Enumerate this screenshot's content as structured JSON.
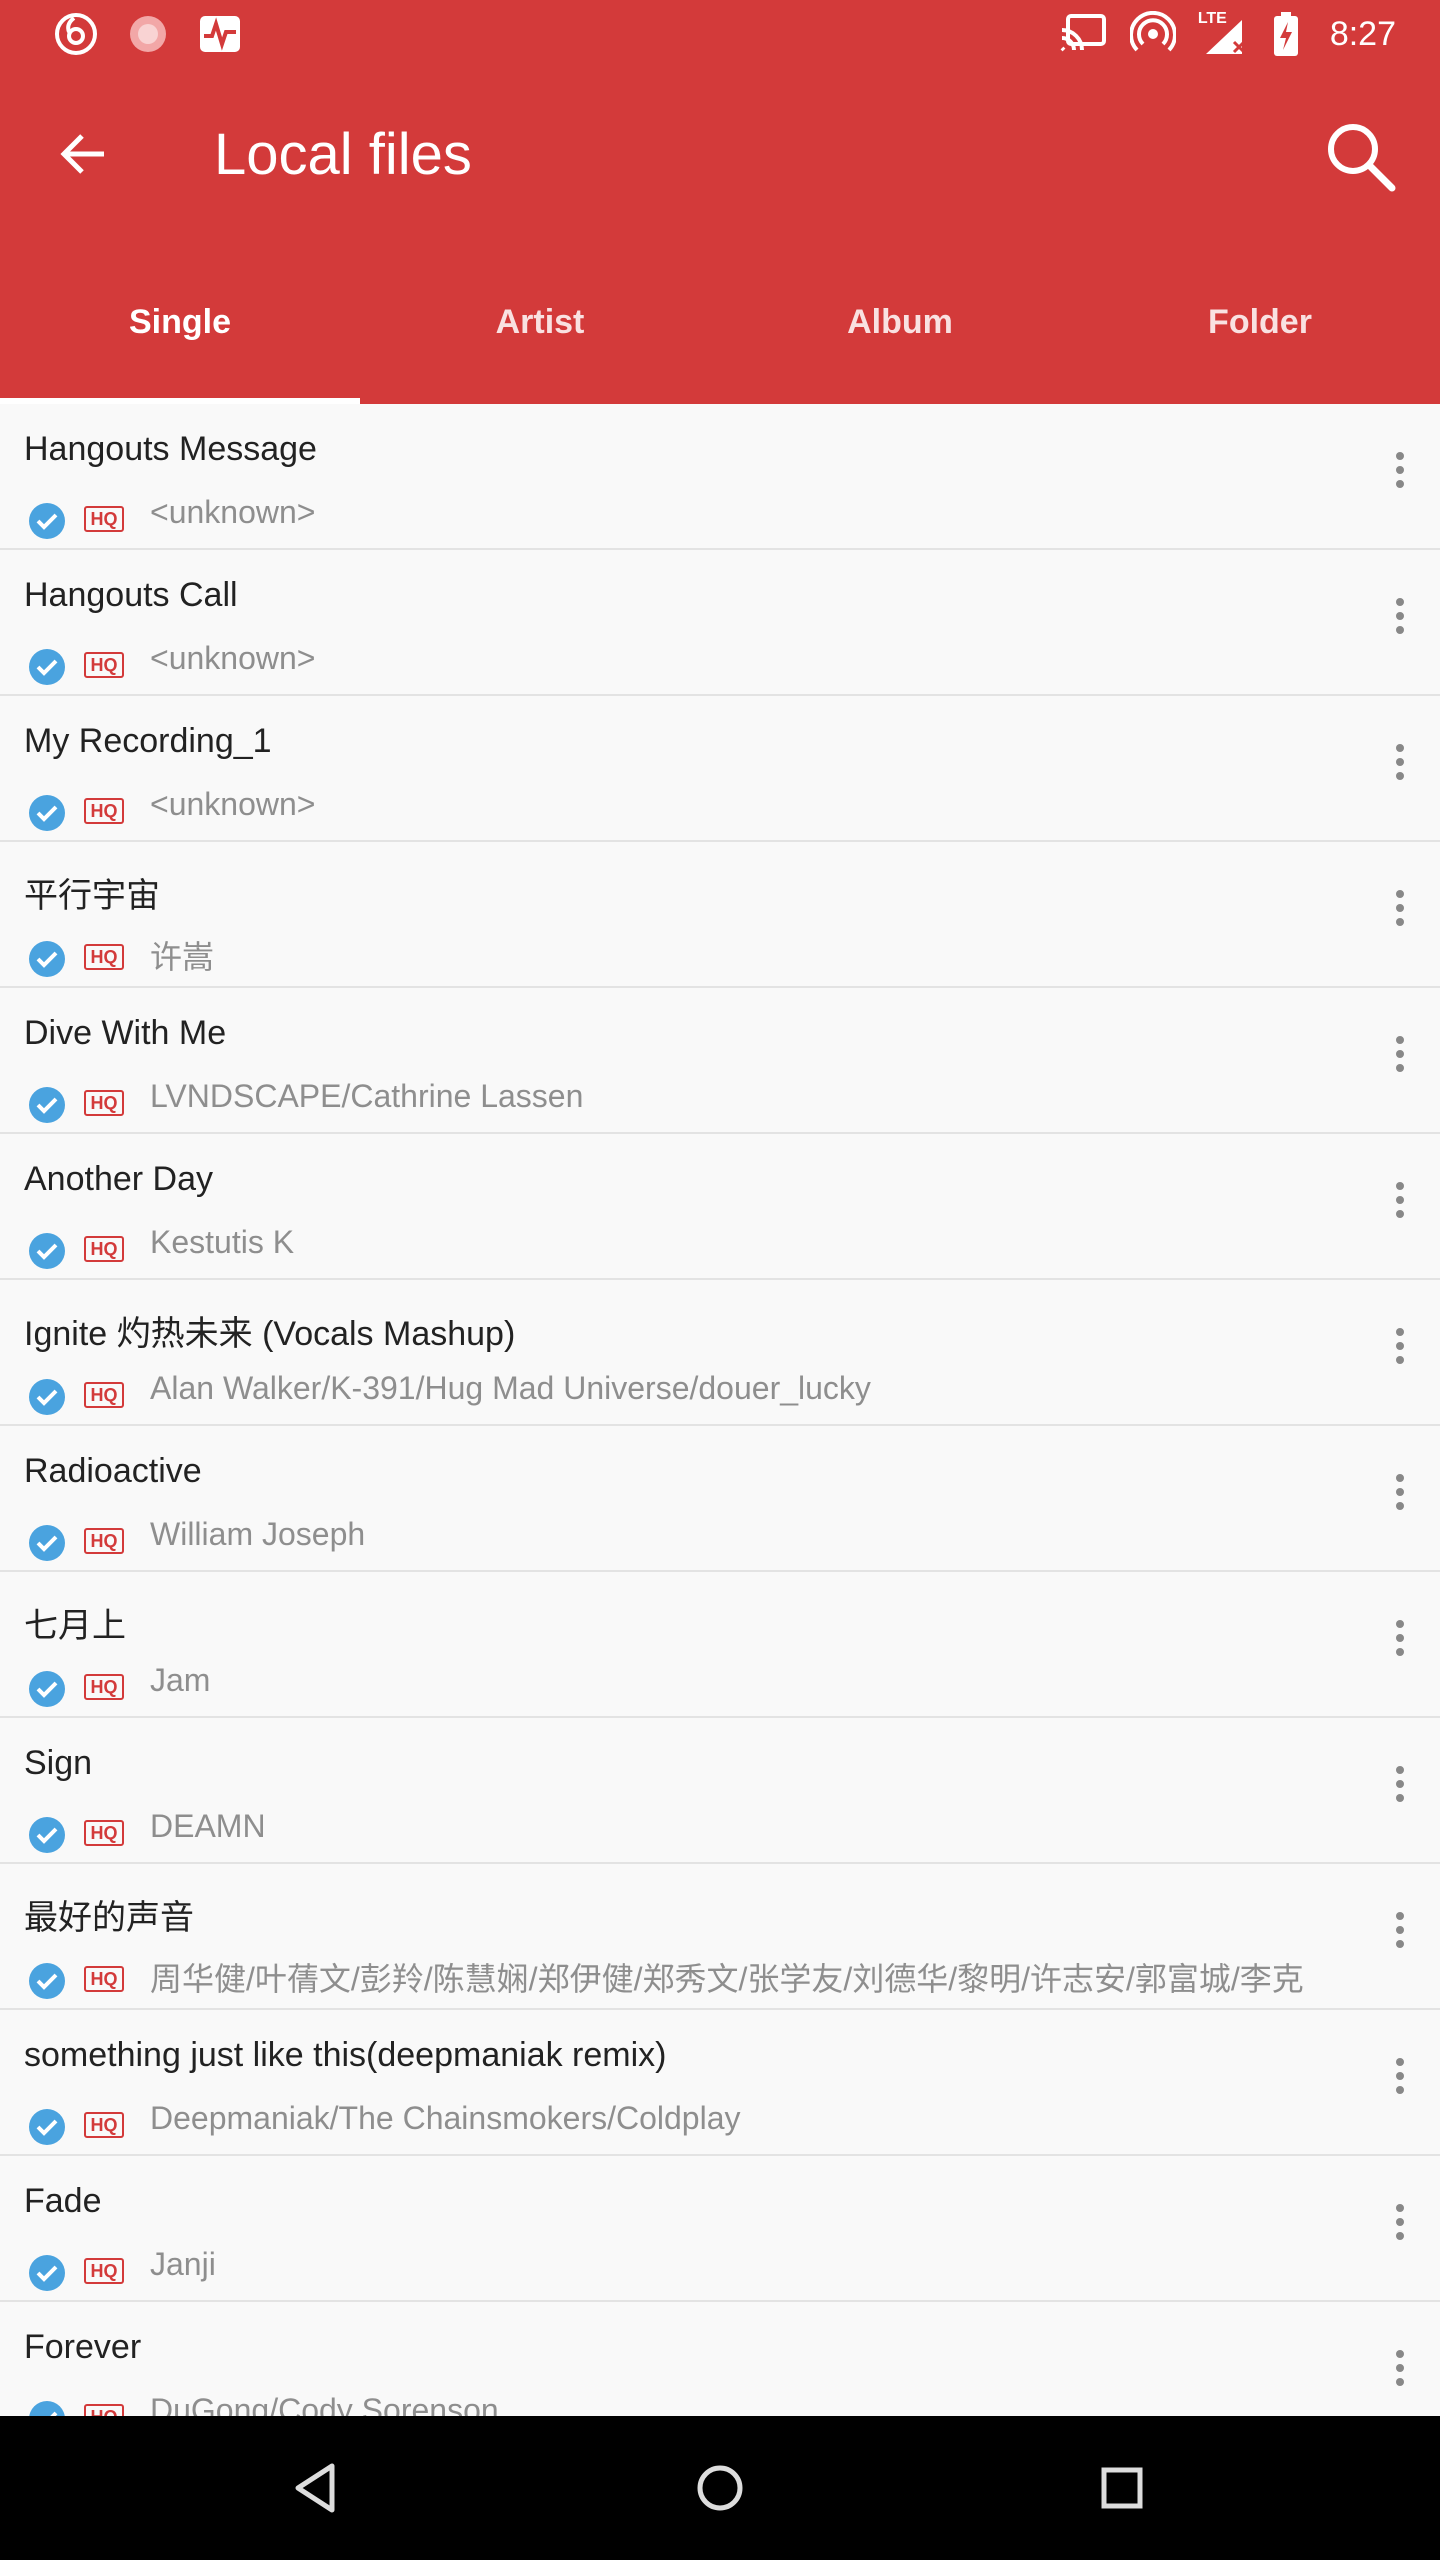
{
  "status_bar": {
    "time": "8:27",
    "network_label": "LTE",
    "left_icons": [
      "netease-icon",
      "sun-icon",
      "activity-icon"
    ],
    "right_icons": [
      "cast-icon",
      "hotspot-icon",
      "signal-icon",
      "battery-icon"
    ]
  },
  "toolbar": {
    "title": "Local files",
    "back_icon": "arrow-left-icon",
    "search_icon": "search-icon"
  },
  "tabs": [
    {
      "label": "Single",
      "active": true
    },
    {
      "label": "Artist",
      "active": false
    },
    {
      "label": "Album",
      "active": false
    },
    {
      "label": "Folder",
      "active": false
    }
  ],
  "songs": [
    {
      "title": "Hangouts Message",
      "artist": "<unknown>"
    },
    {
      "title": "Hangouts Call",
      "artist": "<unknown>"
    },
    {
      "title": "My Recording_1",
      "artist": "<unknown>"
    },
    {
      "title": "平行宇宙",
      "artist": "许嵩"
    },
    {
      "title": "Dive With Me",
      "artist": "LVNDSCAPE/Cathrine Lassen"
    },
    {
      "title": "Another Day",
      "artist": "Kestutis K"
    },
    {
      "title": "Ignite 灼热未来 (Vocals Mashup)",
      "artist": "Alan Walker/K-391/Hug Mad Universe/douer_lucky"
    },
    {
      "title": "Radioactive",
      "artist": "William Joseph"
    },
    {
      "title": "七月上",
      "artist": "Jam"
    },
    {
      "title": "Sign",
      "artist": "DEAMN"
    },
    {
      "title": "最好的声音",
      "artist": "周华健/叶蒨文/彭羚/陈慧娴/郑伊健/郑秀文/张学友/刘德华/黎明/许志安/郭富城/李克"
    },
    {
      "title": "something just like this(deepmaniak remix)",
      "artist": "Deepmaniak/The Chainsmokers/Coldplay"
    },
    {
      "title": "Fade",
      "artist": "Janji"
    },
    {
      "title": "Forever",
      "artist": "DuGong/Cody Sorenson"
    }
  ],
  "quality_badge": "HQ",
  "colors": {
    "brand": "#d33a3a",
    "downloaded_check": "#4aa3df",
    "secondary_text": "#8e8e8e"
  },
  "navbar": [
    "back-triangle-icon",
    "home-circle-icon",
    "recents-square-icon"
  ]
}
